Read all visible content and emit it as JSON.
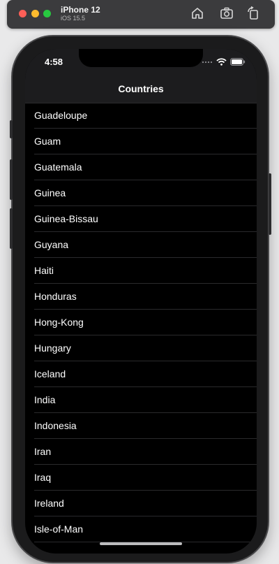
{
  "simulator": {
    "device_name": "iPhone 12",
    "os_version": "iOS 15.5",
    "icons": [
      "home-icon",
      "screenshot-icon",
      "rotate-icon"
    ]
  },
  "status_bar": {
    "time": "4:58",
    "icons": [
      "signal-dots-icon",
      "wifi-icon",
      "battery-icon"
    ]
  },
  "nav": {
    "title": "Countries"
  },
  "countries": [
    "Guadeloupe",
    "Guam",
    "Guatemala",
    "Guinea",
    "Guinea-Bissau",
    "Guyana",
    "Haiti",
    "Honduras",
    "Hong-Kong",
    "Hungary",
    "Iceland",
    "India",
    "Indonesia",
    "Iran",
    "Iraq",
    "Ireland",
    "Isle-of-Man"
  ],
  "colors": {
    "background": "#000000",
    "nav_background": "#1c1c1e",
    "text": "#ffffff",
    "separator": "#2a2a2c"
  }
}
